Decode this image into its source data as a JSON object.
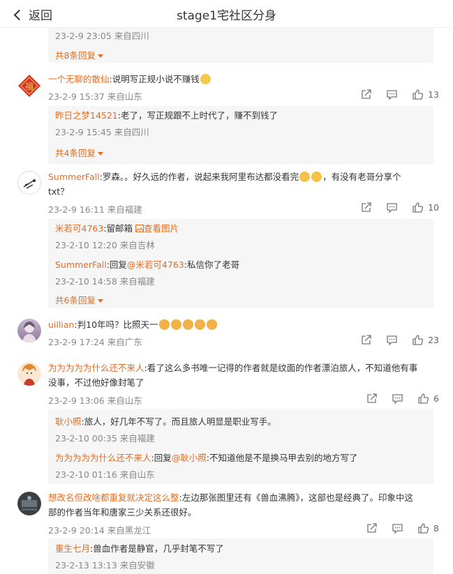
{
  "header": {
    "back_label": "返回",
    "title": "stage1宅社区分身"
  },
  "top": {
    "meta": "23-2-9 23:05 来自四川",
    "more": "共8条回复"
  },
  "comments": [
    {
      "nick": "一个无聊的散仙",
      "text": ":说明写正规小说不赚钱",
      "emoji": "thinking-emoji",
      "meta": "23-2-9 15:37 来自山东",
      "likes": "13",
      "replies": [
        {
          "nick": "昨日之梦14521",
          "text": ":老了，写正规跟不上时代了，赚不到钱了",
          "meta": "23-2-9 15:45 来自四川"
        }
      ],
      "more": "共4条回复"
    },
    {
      "nick": "SummerFall",
      "text_line1": ":罗森。。好久远的作者，说起来我阿里布达都没看完",
      "text_line1b": "，有没有老哥分享个",
      "text_line2": "txt？",
      "meta": "23-2-9 16:11 来自福建",
      "likes": "10",
      "replies": [
        {
          "nick": "米若可4763",
          "text": ":留邮箱",
          "view_pic": "查看图片",
          "meta": "23-2-10 12:20 来自吉林"
        },
        {
          "nick": "SummerFall",
          "reply_prefix": ":回复",
          "at": "@米若可4763",
          "text": ":私信你了老哥",
          "meta": "23-2-10 14:58 来自福建"
        }
      ],
      "more": "共6条回复"
    },
    {
      "nick": "uillian",
      "text": ":判10年吗？比照天一",
      "meta": "23-2-9 17:24 来自广东",
      "likes": "23"
    },
    {
      "nick": "为为为为为什么还不来人",
      "text_line1": ":看了这么多书唯一记得的作者就是纹面的作者漂泊旅人，不知道他有事",
      "text_line2": "没事，不过他好像封笔了",
      "meta": "23-2-9 13:06 来自山东",
      "likes": "6",
      "replies": [
        {
          "nick": "耿小照",
          "text": ":旅人，好几年不写了。而且旅人明显是职业写手。",
          "meta": "23-2-10 00:35 来自福建"
        },
        {
          "nick": "为为为为为什么还不来人",
          "reply_prefix": ":回复",
          "at": "@耿小照",
          "text": ":不知道他是不是换马甲去别的地方写了",
          "meta": "23-2-10 01:16 来自山东"
        }
      ]
    },
    {
      "nick": "想改名但改啥都重复就决定这么整",
      "text_line1": ":左边那张图里还有《兽血沸腾》，这部也是经典了。印象中这",
      "text_line2": "部的作者当年和唐家三少关系还很好。",
      "meta": "23-2-9 20:14 来自黑龙江",
      "likes": "8",
      "replies": [
        {
          "nick": "重生七月",
          "text": ":兽血作者是静官，几乎封笔不写了",
          "meta": "23-2-13 13:13 来自安徽"
        }
      ]
    }
  ],
  "colors": {
    "accent": "#e86b1f",
    "meta": "#888888",
    "reply_bg": "#f6f6f6"
  }
}
